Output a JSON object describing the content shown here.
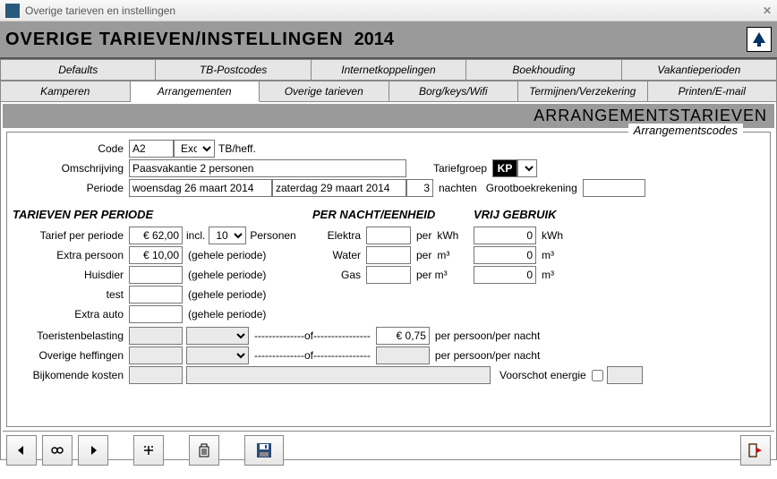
{
  "window": {
    "title": "Overige tarieven en instellingen"
  },
  "header": {
    "title": "OVERIGE TARIEVEN/INSTELLINGEN",
    "year": "2014"
  },
  "tabs1": [
    "Defaults",
    "TB-Postcodes",
    "Internetkoppelingen",
    "Boekhouding",
    "Vakantieperioden"
  ],
  "tabs2": [
    "Kamperen",
    "Arrangementen",
    "Overige tarieven",
    "Borg/keys/Wifi",
    "Termijnen/Verzekering",
    "Printen/E-mail"
  ],
  "banner": "ARRANGEMENTSTARIEVEN",
  "legend": "Arrangementscodes",
  "labels": {
    "code": "Code",
    "excl": "Excl",
    "tbheff": "TB/heff.",
    "omschrijving": "Omschrijving",
    "tariefgroep": "Tariefgroep",
    "periode": "Periode",
    "nachten": "nachten",
    "grootboekrekening": "Grootboekrekening",
    "sec1": "TARIEVEN PER PERIODE",
    "sec2": "PER NACHT/EENHEID",
    "sec3": "VRIJ GEBRUIK",
    "tarief_per_periode": "Tarief per periode",
    "incl": "incl.",
    "personen": "Personen",
    "extra_persoon": "Extra persoon",
    "gehele_periode": "(gehele periode)",
    "huisdier": "Huisdier",
    "test": "test",
    "extra_auto": "Extra auto",
    "toeristenbelasting": "Toeristenbelasting",
    "of": "--------------of----------------",
    "per_persoon_per_nacht": "per persoon/per nacht",
    "overige_heffingen": "Overige heffingen",
    "bijkomende_kosten": "Bijkomende kosten",
    "voorschot_energie": "Voorschot energie",
    "elektra": "Elektra",
    "water": "Water",
    "gas": "Gas",
    "per": "per",
    "kwh": "kWh",
    "m3": "m³",
    "perm3": "per m³"
  },
  "values": {
    "code": "A2",
    "omschrijving": "Paasvakantie 2 personen",
    "tariefgroep": "KP",
    "periode_from": "woensdag 26 maart 2014",
    "periode_to": "zaterdag 29 maart 2014",
    "nachten": "3",
    "grootboekrekening": "",
    "tarief_per_periode": "€ 62,00",
    "incl_personen": "10",
    "extra_persoon": "€ 10,00",
    "huisdier": "",
    "test": "",
    "extra_auto": "",
    "toeristenbelasting1": "",
    "toeristenbelasting2": "",
    "tb_per_nacht": "€ 0,75",
    "overige_heffingen1": "",
    "overige_heffingen2": "",
    "oh_per_nacht": "",
    "bijkomende_kosten1": "",
    "bijkomende_kosten2": "",
    "voorschot_energie": "",
    "elektra": "",
    "water": "",
    "gas": "",
    "vrij_elektra": "0",
    "vrij_water": "0",
    "vrij_gas": "0"
  }
}
